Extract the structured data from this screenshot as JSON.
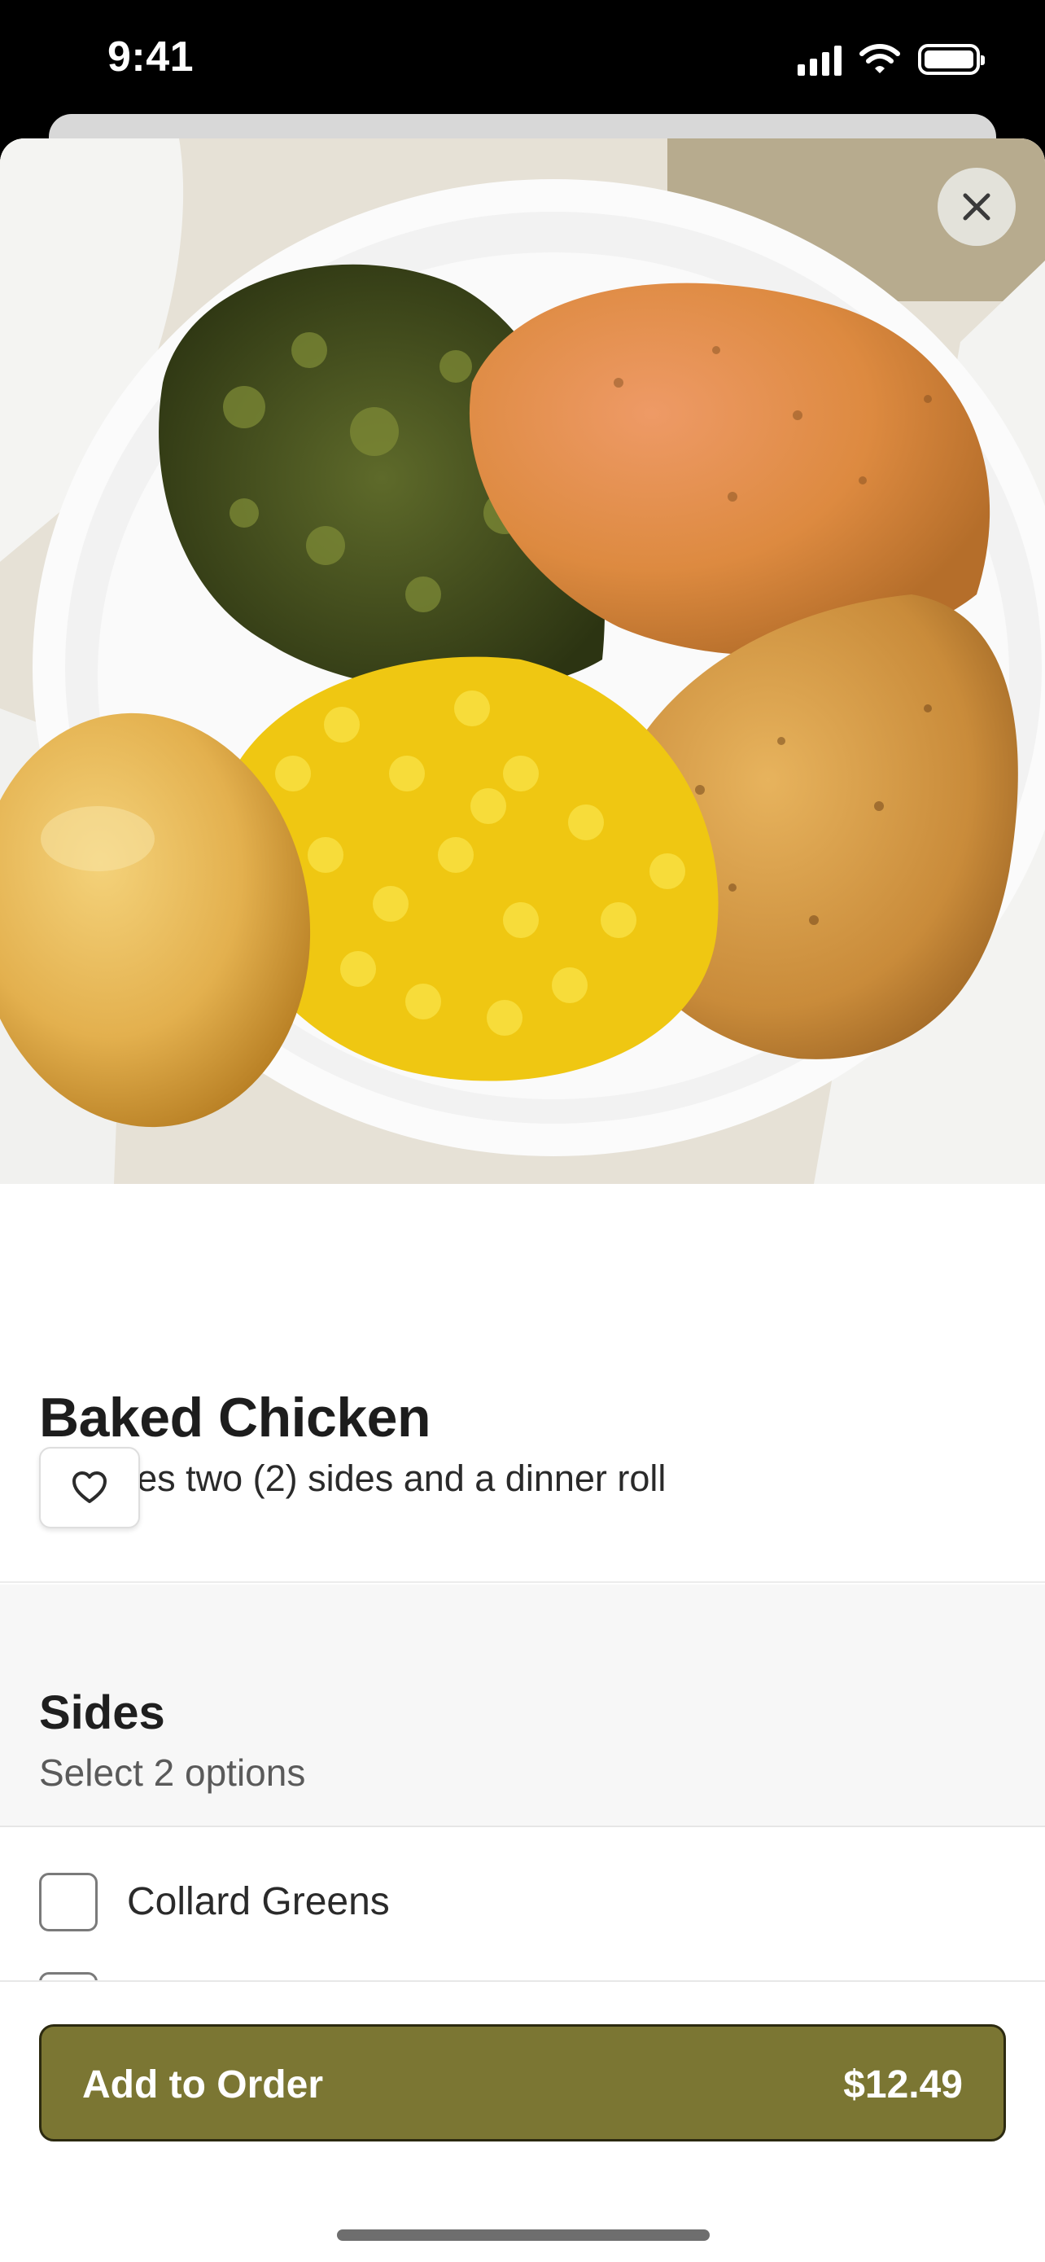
{
  "status_bar": {
    "time": "9:41"
  },
  "hero": {
    "image_subject": "Baked chicken plate with collard greens, corn and a dinner roll",
    "close_icon": "close-icon"
  },
  "item": {
    "title": "Baked Chicken",
    "description": "Includes two (2) sides and a dinner roll",
    "favorite_icon": "heart-icon"
  },
  "sides": {
    "title": "Sides",
    "subtitle": "Select 2 options",
    "options": [
      {
        "label": "Collard Greens",
        "checked": false
      },
      {
        "label": "",
        "checked": false
      }
    ]
  },
  "footer": {
    "add_label": "Add to Order",
    "price": "$12.49"
  },
  "colors": {
    "accent": "#7b7633",
    "accent_border": "#2c2a10",
    "section_bg": "#f7f7f7"
  }
}
